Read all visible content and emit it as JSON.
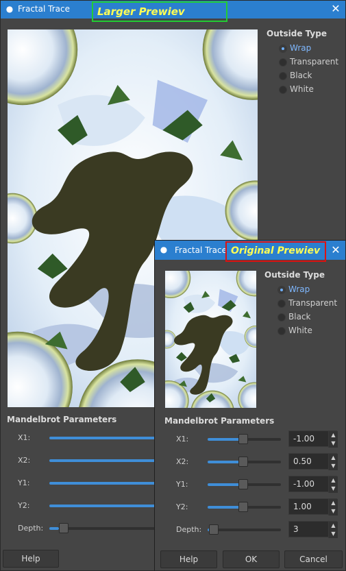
{
  "larger_window": {
    "title": "Fractal Trace",
    "annotation": "Larger Prewiev",
    "outside_type": {
      "title": "Outside Type",
      "options": [
        {
          "label": "Wrap",
          "selected": true
        },
        {
          "label": "Transparent",
          "selected": false
        },
        {
          "label": "Black",
          "selected": false
        },
        {
          "label": "White",
          "selected": false
        }
      ]
    },
    "mandelbrot": {
      "title": "Mandelbrot Parameters",
      "params": [
        {
          "label": "X1:"
        },
        {
          "label": "X2:"
        },
        {
          "label": "Y1:"
        },
        {
          "label": "Y2:"
        },
        {
          "label": "Depth:"
        }
      ]
    },
    "help_label": "Help"
  },
  "original_window": {
    "title": "Fractal Trace",
    "annotation": "Original Prewiev",
    "outside_type": {
      "title": "Outside Type",
      "options": [
        {
          "label": "Wrap",
          "selected": true
        },
        {
          "label": "Transparent",
          "selected": false
        },
        {
          "label": "Black",
          "selected": false
        },
        {
          "label": "White",
          "selected": false
        }
      ]
    },
    "mandelbrot": {
      "title": "Mandelbrot Parameters",
      "params": [
        {
          "label": "X1:",
          "value": "-1.00"
        },
        {
          "label": "X2:",
          "value": "0.50"
        },
        {
          "label": "Y1:",
          "value": "-1.00"
        },
        {
          "label": "Y2:",
          "value": "1.00"
        },
        {
          "label": "Depth:",
          "value": "3"
        }
      ]
    },
    "buttons": {
      "help": "Help",
      "ok": "OK",
      "cancel": "Cancel"
    }
  },
  "icons": {
    "app": "gimp-icon",
    "close": "close-icon",
    "spin_up": "chevron-up-icon",
    "spin_down": "chevron-down-icon"
  },
  "colors": {
    "titlebar": "#2b7fcf",
    "accent": "#3f8ed8",
    "larger_annotation_border": "#22cc33",
    "original_annotation_border": "#dd1111",
    "annotation_text": "#ffff55"
  }
}
